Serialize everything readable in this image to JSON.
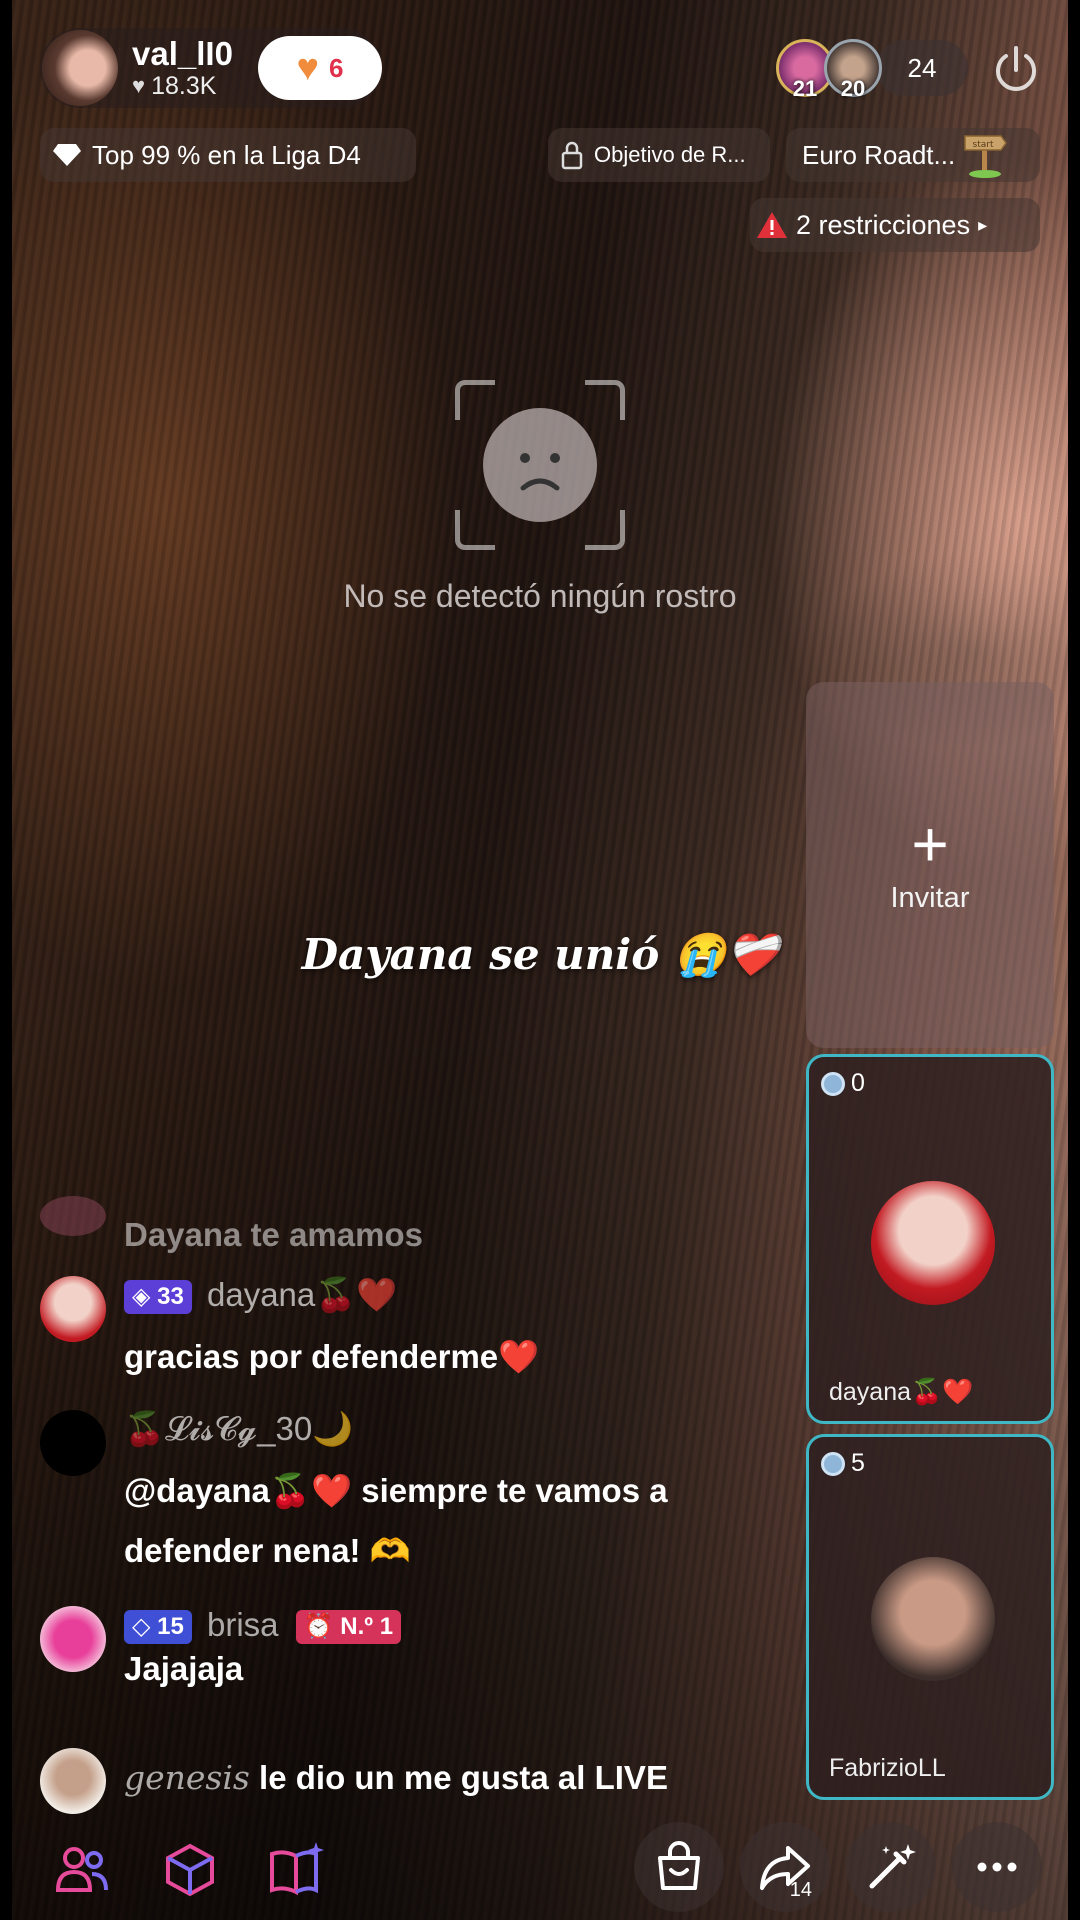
{
  "host": {
    "name": "val_lI0",
    "likes": "18.3K",
    "follow_count": "6"
  },
  "viewers": {
    "top1": "21",
    "top2": "20",
    "count": "24"
  },
  "chips": {
    "league": "Top 99 % en la Liga D4",
    "goal": "Objetivo de R...",
    "roadtrip": "Euro Roadt...",
    "roadtrip_sign": "start",
    "restrictions": "2 restricciones"
  },
  "no_face": "No se detectó ningún rostro",
  "join_banner": "Dayana se unió 😭❤️‍🩹",
  "invite": {
    "plus": "+",
    "label": "Invitar"
  },
  "guests": [
    {
      "score": "0",
      "name": "dayana🍒❤️"
    },
    {
      "score": "5",
      "name": "FabrizioLL"
    }
  ],
  "chat": {
    "partial": "Dayana te amamos",
    "m1": {
      "badge": "33",
      "user": "dayana🍒❤️",
      "text": "gracias por defenderme❤️"
    },
    "m2": {
      "user": "🍒𝓛𝓲𝓼𝓒𝓰_30🌙",
      "line1": "@dayana🍒❤️ siempre te vamos a",
      "line2": "defender nena! 🫶"
    },
    "m3": {
      "badge": "15",
      "user": "brisa",
      "rank": "N.º 1",
      "text": "Jajajaja"
    },
    "m4": {
      "user": "genesis",
      "text": "le dio un me gusta al LIVE"
    }
  },
  "bottom": {
    "share_count": "14"
  },
  "colors": {
    "accent_pink": "#e0304b",
    "guest_border": "#3fb7c4",
    "badge_purple": "#5b3fd6",
    "icon_pink": "#e64a9a"
  }
}
